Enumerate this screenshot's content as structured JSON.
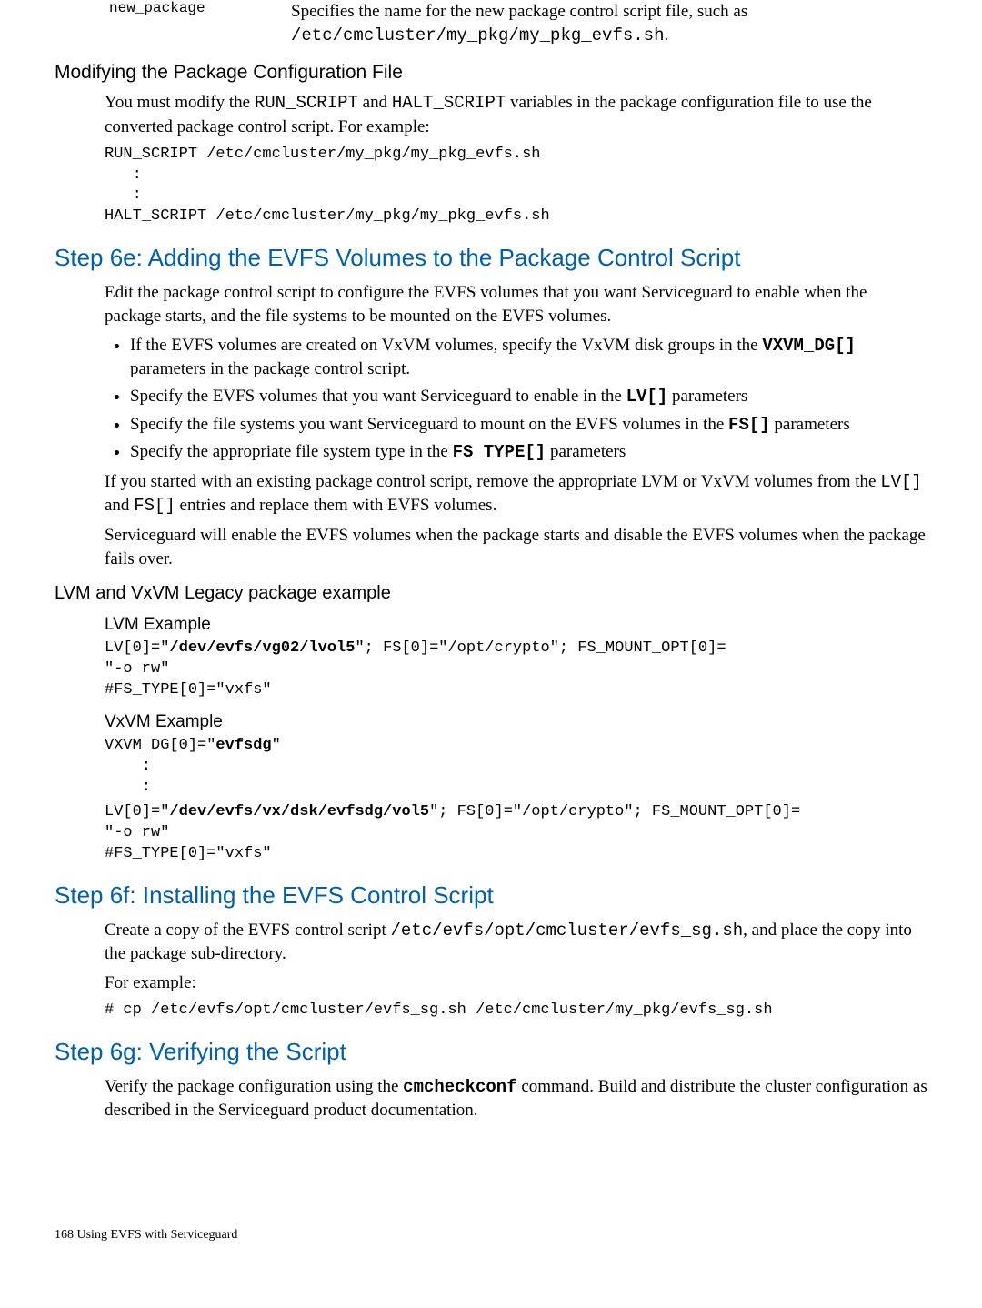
{
  "def": {
    "term": "new_package",
    "desc_a": "Specifies the name for the new package control script file, such as ",
    "desc_b": "/etc/cmcluster/my_pkg/my_pkg_evfs.sh",
    "desc_c": "."
  },
  "mod_heading": "Modifying the Package Configuration File",
  "mod_p_a": "You must modify the ",
  "mod_p_b": "RUN_SCRIPT",
  "mod_p_c": " and ",
  "mod_p_d": "HALT_SCRIPT",
  "mod_p_e": " variables in the package configuration file to use the converted package control script. For example:",
  "mod_code": "RUN_SCRIPT /etc/cmcluster/my_pkg/my_pkg_evfs.sh\n   :\n   :\nHALT_SCRIPT /etc/cmcluster/my_pkg/my_pkg_evfs.sh",
  "s6e_heading": "Step 6e: Adding the EVFS Volumes to the Package Control Script",
  "s6e_p1": "Edit the package control script to configure the EVFS volumes that you want Serviceguard to enable when the package starts, and the file systems to be mounted on the EVFS volumes.",
  "s6e_b1_a": "If the EVFS volumes are created on VxVM volumes, specify the VxVM disk groups in the ",
  "s6e_b1_b": "VXVM_DG[]",
  "s6e_b1_c": " parameters in the package control script.",
  "s6e_b2_a": "Specify the EVFS volumes that you want Serviceguard to enable in the ",
  "s6e_b2_b": "LV[]",
  "s6e_b2_c": " parameters",
  "s6e_b3_a": "Specify the file systems you want Serviceguard to mount on the EVFS volumes in the ",
  "s6e_b3_b": "FS[]",
  "s6e_b3_c": " parameters",
  "s6e_b4_a": "Specify the appropriate file system type in the ",
  "s6e_b4_b": "FS_TYPE[]",
  "s6e_b4_c": " parameters",
  "s6e_p2_a": "If you started with an existing package control script, remove the appropriate LVM or VxVM volumes from the  ",
  "s6e_p2_b": "LV[]",
  "s6e_p2_c": " and ",
  "s6e_p2_d": "FS[]",
  "s6e_p2_e": " entries and replace them with EVFS volumes.",
  "s6e_p3": "Serviceguard will enable the EVFS volumes when the package starts and disable the EVFS volumes when the package fails over.",
  "legacy_heading": "LVM and VxVM Legacy package example",
  "lvm_heading": "LVM Example",
  "lvm_code_a": "LV[0]=\"",
  "lvm_code_b": "/dev/evfs/vg02/lvol5",
  "lvm_code_c": "\"; FS[0]=\"/opt/crypto\"; FS_MOUNT_OPT[0]=\n\"-o rw\"\n#FS_TYPE[0]=\"vxfs\"",
  "vxvm_heading": "VxVM Example",
  "vxvm_code1_a": "VXVM_DG[0]=\"",
  "vxvm_code1_b": "evfsdg",
  "vxvm_code1_c": "\"\n    :\n    :",
  "vxvm_code2_a": "LV[0]=\"",
  "vxvm_code2_b": "/dev/evfs/vx/dsk/evfsdg/vol5",
  "vxvm_code2_c": "\"; FS[0]=\"/opt/crypto\"; FS_MOUNT_OPT[0]=\n\"-o rw\"\n#FS_TYPE[0]=\"vxfs\"",
  "s6f_heading": "Step 6f: Installing the EVFS Control Script",
  "s6f_p1_a": "Create a copy of the EVFS control script ",
  "s6f_p1_b": "/etc/evfs/opt/cmcluster/evfs_sg.sh",
  "s6f_p1_c": ", and place the copy into the package sub-directory.",
  "s6f_p2": "For example:",
  "s6f_code_a": "# ",
  "s6f_code_b": "cp /etc/evfs/opt/cmcluster/evfs_sg.sh /etc/cmcluster/my_pkg/evfs_sg.sh",
  "s6g_heading": "Step 6g: Verifying the Script",
  "s6g_p1_a": "Verify the package configuration using the ",
  "s6g_p1_b": "cmcheckconf",
  "s6g_p1_c": " command. Build and distribute the cluster configuration as described in the Serviceguard product documentation.",
  "footer": "168   Using EVFS with Serviceguard"
}
